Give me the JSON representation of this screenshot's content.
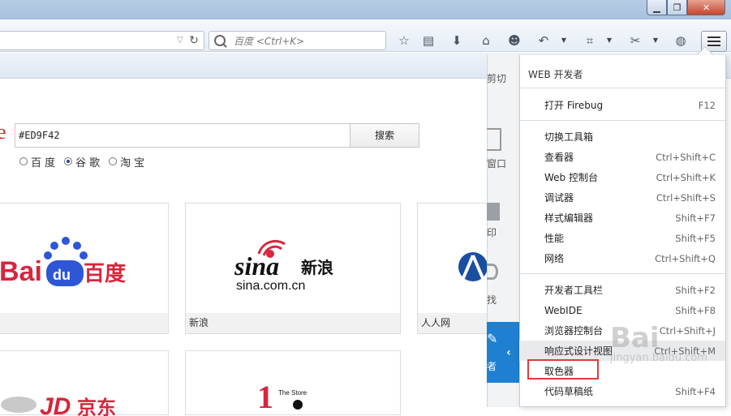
{
  "window": {
    "min": "▁",
    "max": "❐",
    "close": "✕"
  },
  "search": {
    "placeholder": "百度 <Ctrl+K>"
  },
  "toolbar_icons": [
    "star-icon",
    "reader-icon",
    "download-icon",
    "home-icon",
    "smiley-icon",
    "undo-icon",
    "crop-icon",
    "screenshot-icon",
    "globe-icon",
    "menu-icon"
  ],
  "page": {
    "brand_glyph": "e",
    "query_value": "#ED9F42",
    "search_button": "搜索",
    "engines": [
      {
        "label": "百 度",
        "checked": false
      },
      {
        "label": "谷 歌",
        "checked": true
      },
      {
        "label": "淘 宝",
        "checked": false
      }
    ],
    "tiles": [
      {
        "caption": "",
        "logo": "Bai du 百度"
      },
      {
        "caption": "新浪",
        "logo": "sina 新浪 sina.com.cn"
      },
      {
        "caption": "人人网",
        "logo": "renren"
      },
      {
        "caption": "",
        "logo": "JD 京东"
      },
      {
        "caption": "",
        "logo": "The Store"
      }
    ]
  },
  "panel_left": {
    "cut": "剪切",
    "window": "窗口",
    "print": "印",
    "find": "找",
    "developer": "者"
  },
  "devmenu": {
    "title": "WEB 开发者",
    "items": [
      {
        "label": "打开 Firebug",
        "shortcut": "F12"
      },
      {
        "label": "切换工具箱",
        "shortcut": ""
      },
      {
        "label": "查看器",
        "shortcut": "Ctrl+Shift+C"
      },
      {
        "label": "Web 控制台",
        "shortcut": "Ctrl+Shift+K"
      },
      {
        "label": "调试器",
        "shortcut": "Ctrl+Shift+S"
      },
      {
        "label": "样式编辑器",
        "shortcut": "Shift+F7"
      },
      {
        "label": "性能",
        "shortcut": "Shift+F5"
      },
      {
        "label": "网络",
        "shortcut": "Ctrl+Shift+Q"
      },
      {
        "label": "开发者工具栏",
        "shortcut": "Shift+F2"
      },
      {
        "label": "WebIDE",
        "shortcut": "Shift+F8"
      },
      {
        "label": "浏览器控制台",
        "shortcut": "Ctrl+Shift+J"
      },
      {
        "label": "响应式设计视图",
        "shortcut": "Ctrl+Shift+M"
      },
      {
        "label": "取色器",
        "shortcut": ""
      },
      {
        "label": "代码草稿纸",
        "shortcut": "Shift+F4"
      }
    ]
  },
  "colors": {
    "highlight_box": "#e23a3a",
    "panel_blue": "#1f7fd1",
    "baidu_red": "#d7263d",
    "baidu_blue": "#2e56d6"
  },
  "watermark": {
    "paw": "Bai",
    "site": "jingyan.baidu.com"
  }
}
